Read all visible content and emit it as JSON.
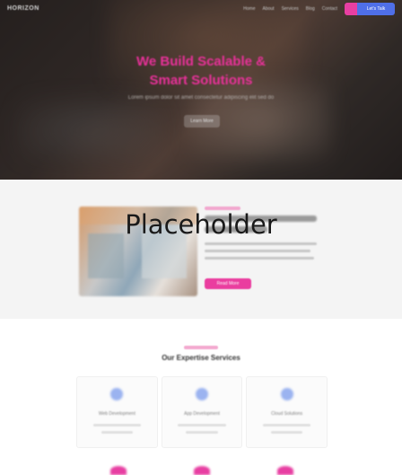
{
  "header": {
    "logo": "HORIZON",
    "nav": [
      "Home",
      "About",
      "Services",
      "Blog",
      "Contact"
    ],
    "cta_label": "Let's Talk"
  },
  "hero": {
    "title_line1": "We Build Scalable &",
    "title_line2": "Smart Solutions",
    "subtitle": "Lorem ipsum dolor sit amet consectetur adipiscing elit sed do",
    "button_label": "Learn More"
  },
  "feature": {
    "placeholder": "Placeholder",
    "button_label": "Read More"
  },
  "services": {
    "title": "Our Expertise Services",
    "cards": [
      {
        "name": "Web Development",
        "icon": "code-icon"
      },
      {
        "name": "App Development",
        "icon": "mobile-icon"
      },
      {
        "name": "Cloud Solutions",
        "icon": "cloud-icon"
      }
    ]
  },
  "colors": {
    "accent_pink": "#e9319a",
    "accent_blue": "#4f6fe8",
    "band_gray": "#f4f4f4"
  }
}
